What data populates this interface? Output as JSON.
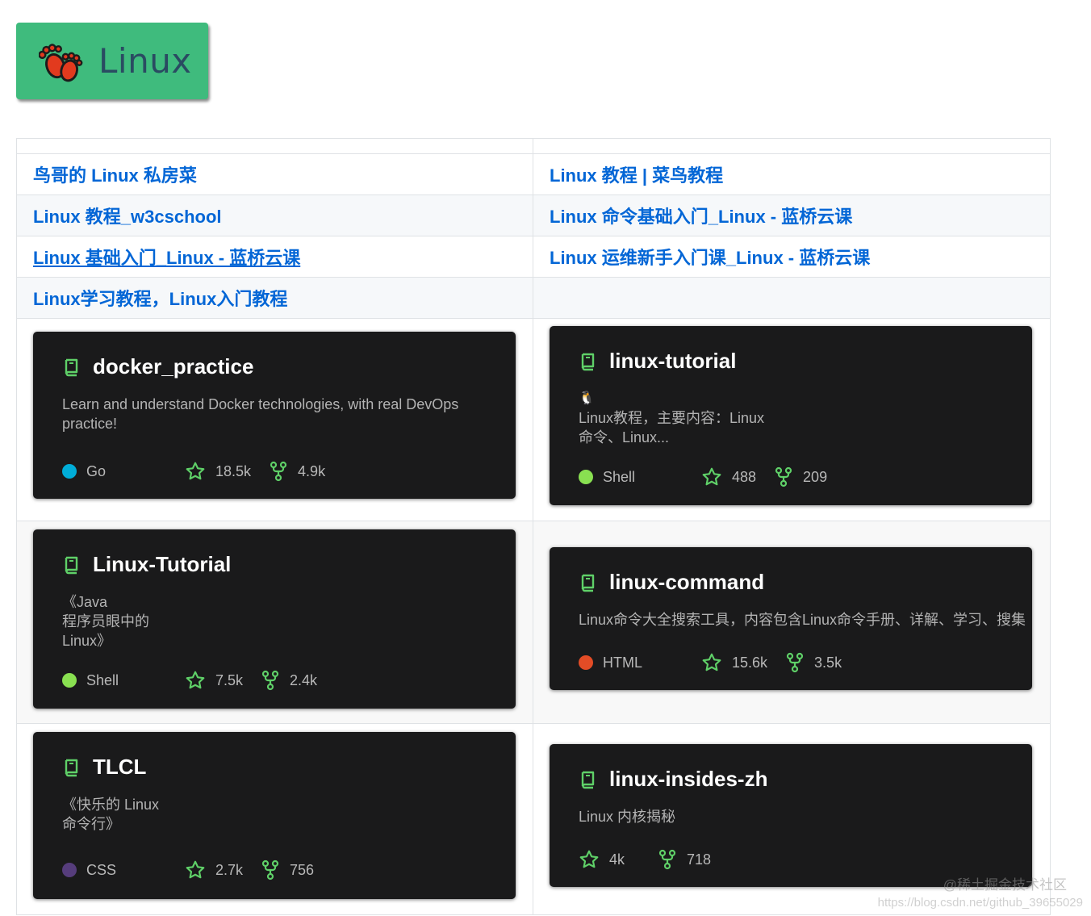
{
  "badge": {
    "label": "Linux",
    "bg_color": "#3fbb7d",
    "icon": "footprints-icon"
  },
  "links": {
    "row1": [
      "鸟哥的 Linux 私房菜",
      "Linux 教程 | 菜鸟教程"
    ],
    "row2": [
      "Linux 教程_w3cschool",
      "Linux 命令基础入门_Linux - 蓝桥云课"
    ],
    "row3": [
      "Linux 基础入门_Linux - 蓝桥云课",
      "Linux 运维新手入门课_Linux - 蓝桥云课"
    ],
    "row4": [
      "Linux学习教程，Linux入门教程",
      ""
    ]
  },
  "cards": [
    {
      "name": "docker_practice",
      "description": "Learn and understand Docker technologies, with real DevOps practice!",
      "language": "Go",
      "language_color": "#00add8",
      "stars": "18.5k",
      "forks": "4.9k"
    },
    {
      "name": "linux-tutorial",
      "emoji": "🐧",
      "description": "Linux教程，主要内容：Linux\n命令、Linux...",
      "language": "Shell",
      "language_color": "#89e051",
      "stars": "488",
      "forks": "209"
    },
    {
      "name": "Linux-Tutorial",
      "description": "《Java\n程序员眼中的\nLinux》",
      "language": "Shell",
      "language_color": "#89e051",
      "stars": "7.5k",
      "forks": "2.4k"
    },
    {
      "name": "linux-command",
      "description": "Linux命令大全搜索工具，内容包含Linux命令手册、详解、学习、搜集",
      "language": "HTML",
      "language_color": "#e34c26",
      "stars": "15.6k",
      "forks": "3.5k"
    },
    {
      "name": "TLCL",
      "description": "《快乐的 Linux\n命令行》",
      "language": "CSS",
      "language_color": "#563d7c",
      "stars": "2.7k",
      "forks": "756"
    },
    {
      "name": "linux-insides-zh",
      "description": "Linux 内核揭秘",
      "language": "",
      "language_color": "",
      "stars": "4k",
      "forks": "718"
    }
  ],
  "icons": {
    "repo": "repo-icon",
    "star": "star-icon",
    "fork": "fork-icon"
  },
  "accent_green": "#5fd068",
  "watermark": {
    "line1": "@稀土掘金技术社区",
    "line2": "https://blog.csdn.net/github_39655029"
  }
}
